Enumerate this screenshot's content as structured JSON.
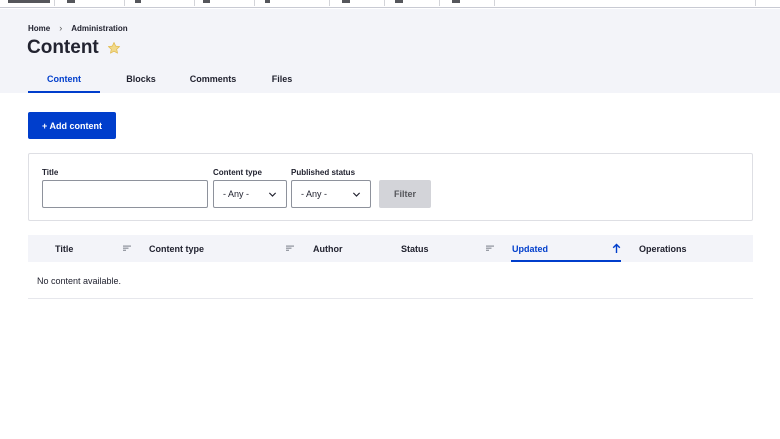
{
  "breadcrumb": {
    "items": [
      "Home",
      "Administration"
    ],
    "separator": "›"
  },
  "page": {
    "title": "Content"
  },
  "tabs": [
    {
      "label": "Content",
      "active": true
    },
    {
      "label": "Blocks",
      "active": false
    },
    {
      "label": "Comments",
      "active": false
    },
    {
      "label": "Files",
      "active": false
    }
  ],
  "actions": {
    "add_content_label": "+ Add content"
  },
  "filters": {
    "title_label": "Title",
    "title_value": "",
    "content_type_label": "Content type",
    "content_type_value": "- Any -",
    "published_status_label": "Published status",
    "published_status_value": "- Any -",
    "filter_button_label": "Filter"
  },
  "table": {
    "columns": [
      {
        "label": "Title",
        "sortable": true,
        "active": false
      },
      {
        "label": "Content type",
        "sortable": true,
        "active": false
      },
      {
        "label": "Author",
        "sortable": false,
        "active": false
      },
      {
        "label": "Status",
        "sortable": true,
        "active": false
      },
      {
        "label": "Updated",
        "sortable": true,
        "active": true,
        "sort_direction": "ascending"
      },
      {
        "label": "Operations",
        "sortable": false,
        "active": false
      }
    ],
    "empty_message": "No content available."
  },
  "colors": {
    "accent": "#003ecc",
    "header_bg": "#f3f4f9",
    "favorite_star": "#e8c96b",
    "button_disabled_bg": "#d3d4d9"
  },
  "icons": {
    "favorite": "star-outline-icon",
    "sort": "sort-icon",
    "sort_active": "arrow-up-icon",
    "select_chevron": "chevron-down-icon"
  }
}
